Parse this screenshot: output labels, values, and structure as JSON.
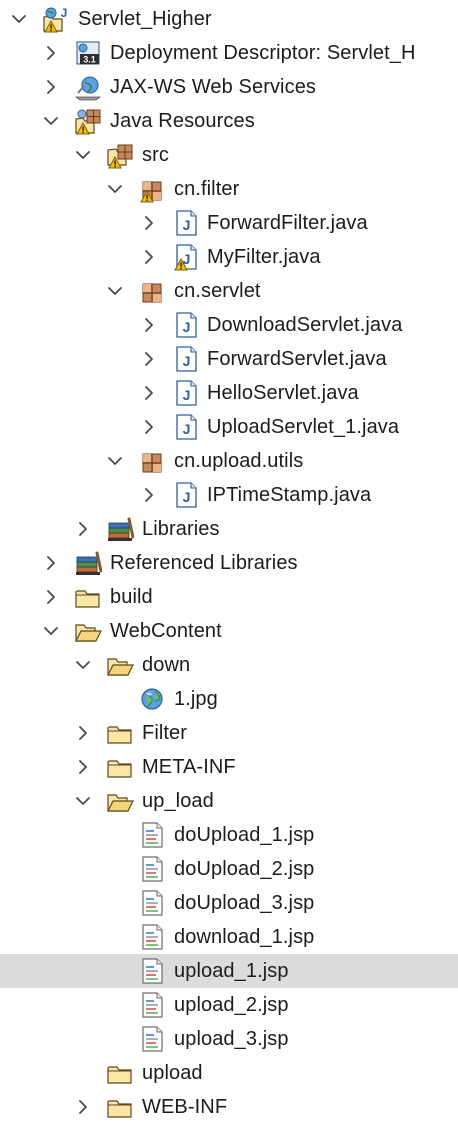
{
  "tree": {
    "items": [
      {
        "label": "Servlet_Higher",
        "icon": "dynamic-web-project-icon",
        "chevron": "expanded",
        "warning": true,
        "depth": 0
      },
      {
        "label": "Deployment Descriptor: Servlet_H",
        "icon": "deployment-descriptor-icon",
        "icon_text": "3.1",
        "chevron": "collapsed",
        "warning": false,
        "depth": 1
      },
      {
        "label": "JAX-WS Web Services",
        "icon": "web-services-icon",
        "chevron": "collapsed",
        "warning": false,
        "depth": 1
      },
      {
        "label": "Java Resources",
        "icon": "java-resources-icon",
        "chevron": "expanded",
        "warning": true,
        "depth": 1
      },
      {
        "label": "src",
        "icon": "source-folder-icon",
        "chevron": "expanded",
        "warning": true,
        "depth": 2
      },
      {
        "label": "cn.filter",
        "icon": "package-icon",
        "chevron": "expanded",
        "warning": true,
        "depth": 3
      },
      {
        "label": "ForwardFilter.java",
        "icon": "java-file-icon",
        "icon_text": "J",
        "chevron": "collapsed",
        "warning": false,
        "depth": 4
      },
      {
        "label": "MyFilter.java",
        "icon": "java-file-icon",
        "icon_text": "J",
        "chevron": "collapsed",
        "warning": true,
        "depth": 4
      },
      {
        "label": "cn.servlet",
        "icon": "package-icon",
        "chevron": "expanded",
        "warning": false,
        "depth": 3
      },
      {
        "label": "DownloadServlet.java",
        "icon": "java-file-icon",
        "icon_text": "J",
        "chevron": "collapsed",
        "warning": false,
        "depth": 4
      },
      {
        "label": "ForwardServlet.java",
        "icon": "java-file-icon",
        "icon_text": "J",
        "chevron": "collapsed",
        "warning": false,
        "depth": 4
      },
      {
        "label": "HelloServlet.java",
        "icon": "java-file-icon",
        "icon_text": "J",
        "chevron": "collapsed",
        "warning": false,
        "depth": 4
      },
      {
        "label": "UploadServlet_1.java",
        "icon": "java-file-icon",
        "icon_text": "J",
        "chevron": "collapsed",
        "warning": false,
        "depth": 4
      },
      {
        "label": "cn.upload.utils",
        "icon": "package-icon",
        "chevron": "expanded",
        "warning": false,
        "depth": 3
      },
      {
        "label": "IPTimeStamp.java",
        "icon": "java-file-icon",
        "icon_text": "J",
        "chevron": "collapsed",
        "warning": false,
        "depth": 4
      },
      {
        "label": "Libraries",
        "icon": "libraries-icon",
        "chevron": "collapsed",
        "warning": false,
        "depth": 2
      },
      {
        "label": "Referenced Libraries",
        "icon": "libraries-icon",
        "chevron": "collapsed",
        "warning": false,
        "depth": 1
      },
      {
        "label": "build",
        "icon": "folder-icon",
        "chevron": "collapsed",
        "warning": false,
        "depth": 1
      },
      {
        "label": "WebContent",
        "icon": "folder-open-icon",
        "chevron": "expanded",
        "warning": false,
        "depth": 1
      },
      {
        "label": "down",
        "icon": "folder-open-icon",
        "chevron": "expanded",
        "warning": false,
        "depth": 2
      },
      {
        "label": "1.jpg",
        "icon": "image-globe-icon",
        "chevron": "none",
        "warning": false,
        "depth": 3
      },
      {
        "label": "Filter",
        "icon": "folder-icon",
        "chevron": "collapsed",
        "warning": false,
        "depth": 2
      },
      {
        "label": "META-INF",
        "icon": "folder-icon",
        "chevron": "collapsed",
        "warning": false,
        "depth": 2
      },
      {
        "label": "up_load",
        "icon": "folder-open-icon",
        "chevron": "expanded",
        "warning": false,
        "depth": 2
      },
      {
        "label": "doUpload_1.jsp",
        "icon": "jsp-file-icon",
        "chevron": "none",
        "warning": false,
        "depth": 3
      },
      {
        "label": "doUpload_2.jsp",
        "icon": "jsp-file-icon",
        "chevron": "none",
        "warning": false,
        "depth": 3
      },
      {
        "label": "doUpload_3.jsp",
        "icon": "jsp-file-icon",
        "chevron": "none",
        "warning": false,
        "depth": 3
      },
      {
        "label": "download_1.jsp",
        "icon": "jsp-file-icon",
        "chevron": "none",
        "warning": false,
        "depth": 3
      },
      {
        "label": "upload_1.jsp",
        "icon": "jsp-file-icon",
        "chevron": "none",
        "warning": false,
        "depth": 3,
        "selected": true
      },
      {
        "label": "upload_2.jsp",
        "icon": "jsp-file-icon",
        "chevron": "none",
        "warning": false,
        "depth": 3
      },
      {
        "label": "upload_3.jsp",
        "icon": "jsp-file-icon",
        "chevron": "none",
        "warning": false,
        "depth": 3
      },
      {
        "label": "upload",
        "icon": "folder-icon",
        "chevron": "none",
        "warning": false,
        "depth": 2
      },
      {
        "label": "WEB-INF",
        "icon": "folder-icon",
        "chevron": "collapsed",
        "warning": false,
        "depth": 2
      }
    ]
  },
  "colors": {
    "selection": "#dcdcdc",
    "folder": "#f3cf6f",
    "java_icon": "#2f5f9e",
    "warning": "#f2c100",
    "package": "#a8643c"
  }
}
